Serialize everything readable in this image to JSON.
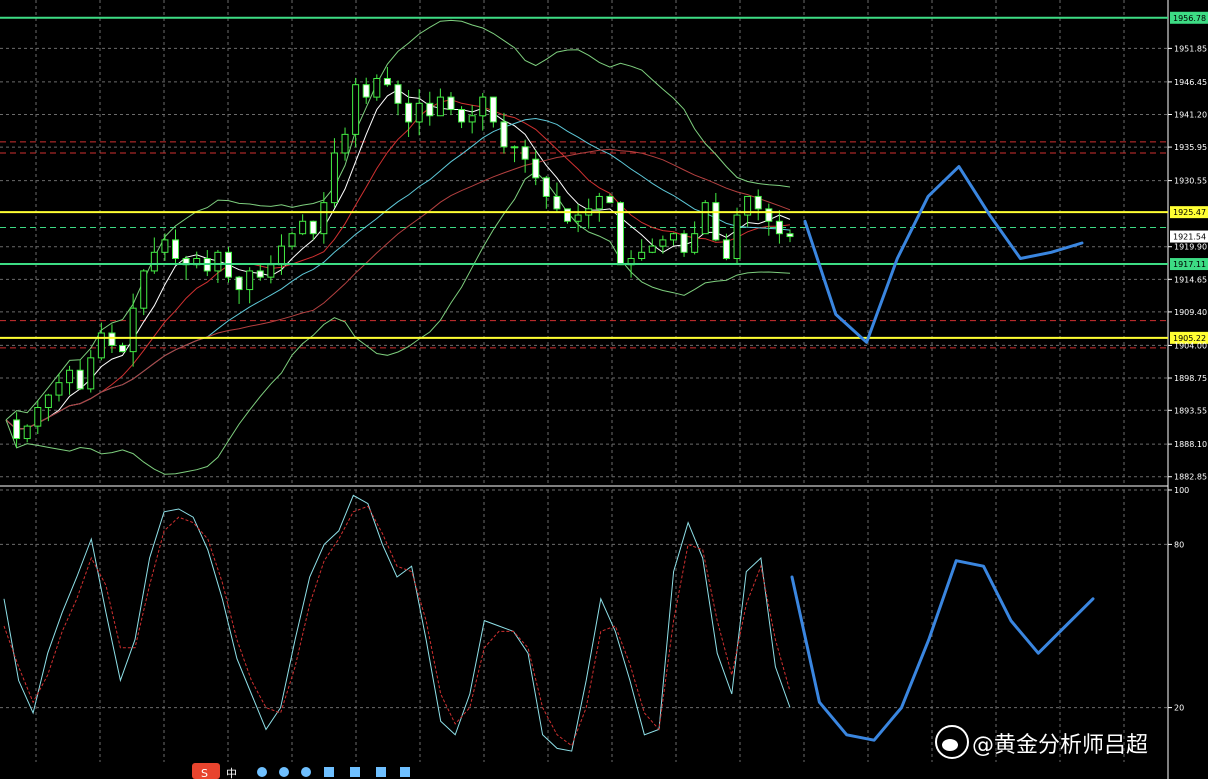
{
  "watermark": {
    "icon": "weibo-icon",
    "text": "@黄金分析师吕超"
  },
  "toolbar": {
    "logo": "S",
    "ime_label": "中"
  },
  "chart_data": [
    {
      "type": "candlestick",
      "title": "",
      "y_ticks": [
        "1951.85",
        "1946.45",
        "1941.20",
        "1935.95",
        "1930.55",
        "1919.90",
        "1914.65",
        "1909.40",
        "1904.00",
        "1898.75",
        "1893.55",
        "1888.10",
        "1882.85"
      ],
      "ylim": [
        1882.0,
        1959.0
      ],
      "grid": true,
      "current_price": {
        "label": "1921.54",
        "value": 1921.54
      },
      "horizontal_levels": [
        {
          "label": "1956.78",
          "value": 1956.78,
          "color": "#3ddc84"
        },
        {
          "label": "1925.47",
          "value": 1925.47,
          "color": "#ffff33"
        },
        {
          "label": "1917.11",
          "value": 1917.11,
          "color": "#3ddc84"
        },
        {
          "label": "1905.22",
          "value": 1905.22,
          "color": "#ffff33"
        }
      ],
      "dashed_levels": [
        {
          "value": 1936.8,
          "color": "#d03030"
        },
        {
          "value": 1935.0,
          "color": "#d03030"
        },
        {
          "value": 1923.0,
          "color": "#3ddc84"
        },
        {
          "value": 1908.0,
          "color": "#d03030"
        },
        {
          "value": 1903.6,
          "color": "#d03030"
        }
      ],
      "close_path": [
        1892,
        1889,
        1891,
        1894,
        1896,
        1898,
        1900,
        1897,
        1902,
        1906,
        1904,
        1903,
        1910,
        1916,
        1919,
        1921,
        1918,
        1917,
        1918,
        1916,
        1919,
        1915,
        1913,
        1916,
        1915,
        1917,
        1920,
        1922,
        1924,
        1922,
        1927,
        1935,
        1938,
        1946,
        1944,
        1947,
        1946,
        1943,
        1940,
        1943,
        1941,
        1944,
        1942,
        1940,
        1941,
        1944,
        1940,
        1936,
        1936,
        1934,
        1931,
        1928,
        1926,
        1924,
        1925,
        1926,
        1928,
        1927,
        1917,
        1918,
        1919,
        1920,
        1921,
        1922,
        1919,
        1922,
        1927,
        1921,
        1918,
        1925,
        1928,
        1926,
        1924,
        1922,
        1921.54
      ],
      "forecast_path": [
        1924,
        1909,
        1904.5,
        1918,
        1928,
        1932.8,
        1925,
        1918,
        1919,
        1920.5
      ]
    },
    {
      "type": "line",
      "title": "",
      "y_ticks": [
        "100",
        "80",
        "20"
      ],
      "ylim": [
        0,
        100
      ],
      "grid": true,
      "series": [
        {
          "color": "#8ee0e8",
          "values": [
            60,
            30,
            18,
            40,
            55,
            68,
            82,
            55,
            30,
            45,
            75,
            92,
            93,
            90,
            78,
            60,
            38,
            25,
            12,
            20,
            45,
            68,
            80,
            85,
            98,
            95,
            80,
            68,
            72,
            45,
            15,
            10,
            25,
            52,
            50,
            48,
            40,
            10,
            5,
            4,
            30,
            60,
            48,
            30,
            10,
            12,
            70,
            88,
            75,
            40,
            25,
            70,
            75,
            35,
            20
          ]
        },
        {
          "color": "#d03030",
          "values": [
            50,
            35,
            22,
            32,
            48,
            60,
            75,
            65,
            42,
            42,
            65,
            85,
            90,
            88,
            82,
            66,
            45,
            30,
            20,
            18,
            35,
            58,
            74,
            82,
            92,
            94,
            84,
            72,
            70,
            52,
            25,
            14,
            20,
            42,
            48,
            48,
            42,
            20,
            10,
            6,
            20,
            48,
            50,
            36,
            18,
            12,
            52,
            80,
            78,
            52,
            32,
            58,
            72,
            45,
            26
          ]
        }
      ],
      "forecast_path": [
        68,
        22,
        10,
        8,
        20,
        45,
        74,
        72,
        52,
        40,
        50,
        60
      ]
    }
  ]
}
